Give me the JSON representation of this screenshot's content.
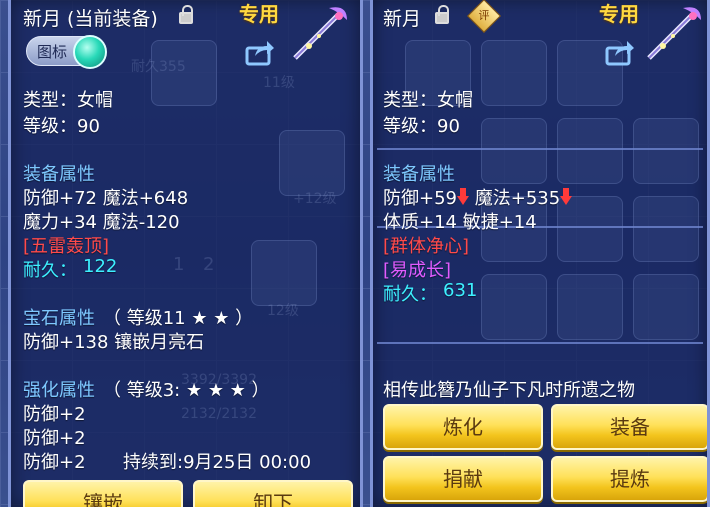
{
  "left_panel": {
    "name": "新月",
    "equipped_tag": "(当前装备)",
    "exclusive": "专用",
    "toggle_label": "图标",
    "type_line": "类型：女帽",
    "level_line": "等级：90",
    "equip_attr_title": "装备属性",
    "attr_line1": "防御+72 魔法+648",
    "attr_line2": "魔力+34 魔法-120",
    "special_skill": "[五雷轰顶]",
    "durability_label": "耐久：",
    "durability_value": "122",
    "gem_title": "宝石属性",
    "gem_level": "（ 等级11 ★ ★ ）",
    "gem_line": "防御+138 镶嵌月亮石",
    "enhance_title": "强化属性",
    "enhance_level": "（ 等级3: ★ ★ ★ ）",
    "enhance_lines": [
      "防御+2",
      "防御+2",
      "防御+2"
    ],
    "duration_text": "持续到:9月25日 00:00",
    "buttons": [
      "镶嵌",
      "卸下"
    ]
  },
  "right_panel": {
    "name": "新月",
    "rating_badge": "评",
    "exclusive": "专用",
    "type_line": "类型：女帽",
    "level_line": "等级：90",
    "equip_attr_title": "装备属性",
    "attr_line1_a": "防御+59",
    "attr_line1_b": "魔法+535",
    "attr_line2": "体质+14 敏捷+14",
    "special_skill": "[群体净心]",
    "special_effect": "[易成长]",
    "durability_label": "耐久：",
    "durability_value": "631",
    "description": "相传此簪乃仙子下凡时所遗之物",
    "buttons": [
      "炼化",
      "装备",
      "捐献",
      "提炼"
    ]
  },
  "background_ghost_text": [
    "耐久355",
    "11级",
    "+12级",
    "12级",
    "1",
    "2",
    "3392/3392",
    "2132/2132"
  ],
  "colors": {
    "section_title": "#7ec8ff",
    "equipped_tag": "#5cff4a",
    "skill_red": "#ff4a4a",
    "effect_purple": "#e05cff",
    "durability_cyan": "#3df0ff",
    "exclusive_gold": "#ffd840",
    "button_gold": "#f3c41d"
  }
}
